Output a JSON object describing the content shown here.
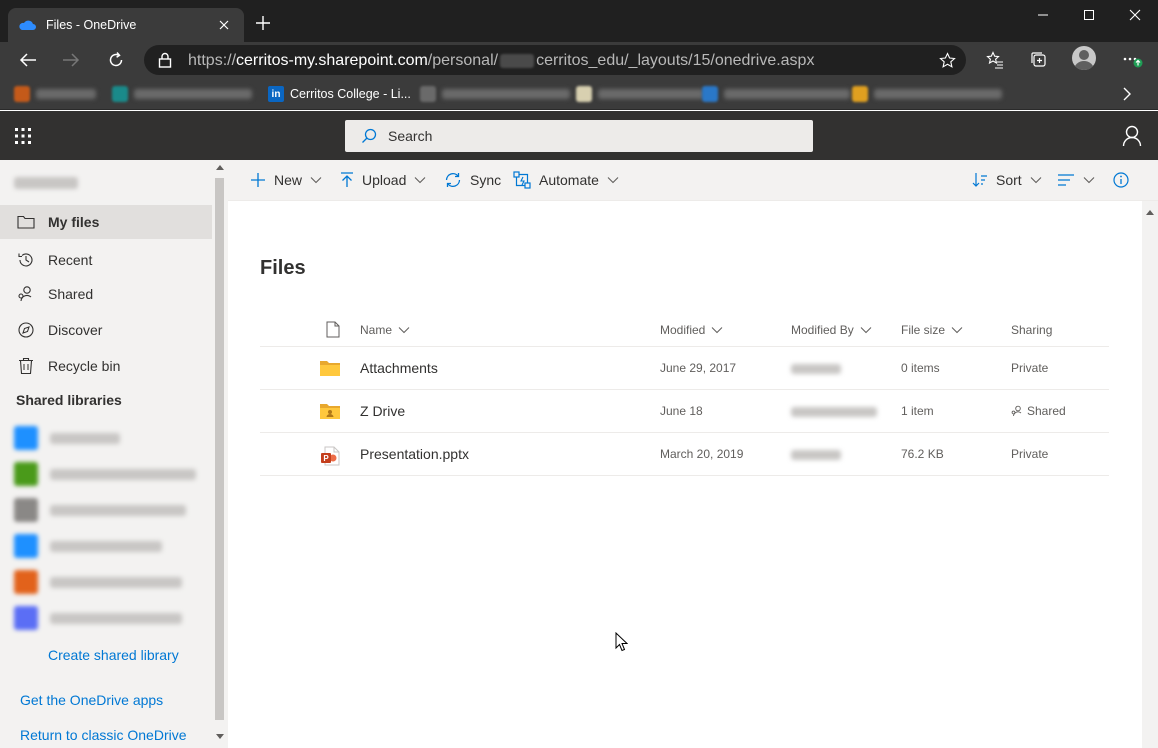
{
  "browser": {
    "tab_title": "Files - OneDrive",
    "url_prefix": "https://",
    "url_host": "cerritos-my.sharepoint.com",
    "url_path_a": "/personal/",
    "url_path_b": "cerritos_edu/_layouts/15/onedrive.aspx",
    "favorites": [
      {
        "label": "Cerritos College - Li...",
        "icon": "linkedin-icon",
        "color": "#0a66c2"
      }
    ],
    "accent": "#0078d4"
  },
  "suite": {
    "search_placeholder": "Search"
  },
  "nav": {
    "items": [
      {
        "label": "My files",
        "icon": "folder-icon",
        "selected": true
      },
      {
        "label": "Recent",
        "icon": "clock-icon"
      },
      {
        "label": "Shared",
        "icon": "shared-icon"
      },
      {
        "label": "Discover",
        "icon": "discover-icon"
      },
      {
        "label": "Recycle bin",
        "icon": "recycle-bin-icon"
      }
    ],
    "shared_libraries_heading": "Shared libraries",
    "library_colors": [
      "#1e90ff",
      "#4a9a1a",
      "#8a8886",
      "#1e90ff",
      "#e2621b",
      "#5b6ef5"
    ],
    "create_shared_library": "Create shared library",
    "get_apps": "Get the OneDrive apps",
    "return_classic": "Return to classic OneDrive"
  },
  "commands": {
    "new": "New",
    "upload": "Upload",
    "sync": "Sync",
    "automate": "Automate",
    "sort": "Sort"
  },
  "main": {
    "title": "Files",
    "columns": {
      "name": "Name",
      "modified": "Modified",
      "modified_by": "Modified By",
      "file_size": "File size",
      "sharing": "Sharing"
    },
    "rows": [
      {
        "name": "Attachments",
        "type": "folder",
        "modified": "June 29, 2017",
        "file_size": "0 items",
        "sharing": "Private"
      },
      {
        "name": "Z Drive",
        "type": "shared-folder",
        "modified": "June 18",
        "file_size": "1 item",
        "sharing": "Shared"
      },
      {
        "name": "Presentation.pptx",
        "type": "pptx",
        "modified": "March 20, 2019",
        "file_size": "76.2 KB",
        "sharing": "Private"
      }
    ]
  }
}
